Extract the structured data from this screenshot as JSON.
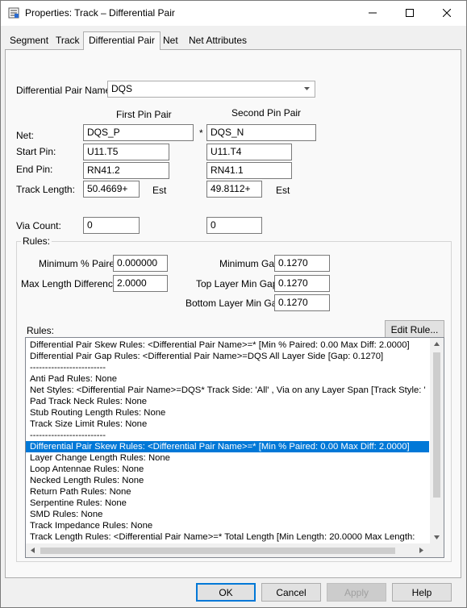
{
  "window": {
    "title": "Properties: Track – Differential Pair"
  },
  "tabs": [
    {
      "label": "Segment"
    },
    {
      "label": "Track"
    },
    {
      "label": "Differential Pair"
    },
    {
      "label": "Net"
    },
    {
      "label": "Net Attributes"
    }
  ],
  "diffpair": {
    "name_label": "Differential Pair Name:",
    "name_value": "DQS",
    "first_header": "First Pin Pair",
    "second_header": "Second Pin Pair",
    "separator": "*",
    "net_label": "Net:",
    "start_label": "Start Pin:",
    "end_label": "End Pin:",
    "length_label": "Track Length:",
    "via_label": "Via Count:",
    "first": {
      "net": "DQS_P",
      "start": "U11.T5",
      "end": "RN41.2",
      "length": "50.4669+",
      "est": "Est",
      "via": "0"
    },
    "second": {
      "net": "DQS_N",
      "start": "U11.T4",
      "end": "RN41.1",
      "length": "49.8112+",
      "est": "Est",
      "via": "0"
    }
  },
  "rules_group": {
    "title": "Rules:",
    "min_paired_label": "Minimum % Paired:",
    "min_paired_value": "0.000000",
    "max_len_diff_label": "Max Length Difference:",
    "max_len_diff_value": "2.0000",
    "min_gap_label": "Minimum Gap:",
    "min_gap_value": "0.1270",
    "top_gap_label": "Top Layer Min Gap:",
    "top_gap_value": "0.1270",
    "bottom_gap_label": "Bottom Layer Min Gap:",
    "bottom_gap_value": "0.1270",
    "rules_list_label": "Rules:",
    "edit_rule_button": "Edit Rule...",
    "rules_list": [
      "Differential Pair Skew Rules: <Differential Pair Name>=*  [Min % Paired: 0.00  Max Diff: 2.0000]",
      "Differential Pair Gap Rules: <Differential Pair Name>=DQS All Layer Side  [Gap: 0.1270]",
      "-------------------------",
      "Anti Pad Rules: None",
      "Net Styles: <Differential Pair Name>=DQS*  Track Side: 'All' , Via on any Layer Span  [Track Style: '",
      "Pad Track Neck Rules: None",
      "Stub Routing Length Rules: None",
      "Track Size Limit Rules: None",
      "-------------------------",
      "Differential Pair Skew Rules: <Differential Pair Name>=*  [Min % Paired: 0.00  Max Diff: 2.0000]",
      "Layer Change Length Rules: None",
      "Loop Antennae Rules: None",
      "Necked Length Rules: None",
      "Return Path Rules: None",
      "Serpentine Rules: None",
      "SMD Rules: None",
      "Track Impedance Rules: None",
      "Track Length Rules: <Differential Pair Name>=* Total Length  [Min Length: 20.0000  Max Length: "
    ],
    "selected_index": 9
  },
  "buttons": {
    "ok": "OK",
    "cancel": "Cancel",
    "apply": "Apply",
    "help": "Help"
  },
  "colors": {
    "selection": "#0078d7",
    "default_button_border": "#0078d7"
  }
}
